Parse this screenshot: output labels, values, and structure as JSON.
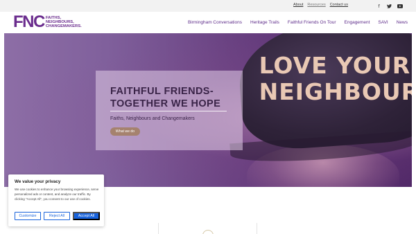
{
  "topbar": {
    "links": [
      "About",
      "Resources",
      "Contact us"
    ],
    "social_icons": [
      "facebook-icon",
      "twitter-icon",
      "youtube-icon"
    ]
  },
  "logo": {
    "mark": "FNC",
    "lines": [
      "FAITHS,",
      "NEIGHBOURS,",
      "CHANGEMAKERS."
    ]
  },
  "nav": {
    "items": [
      "Birmingham Conversations",
      "Heritage Trails",
      "Faithful Friends On Tour",
      "Engagement",
      "SAVI",
      "News"
    ]
  },
  "hero": {
    "cap_text_line1": "LOVE YOUR",
    "cap_text_line2": "NEIGHBOUR",
    "title_line1": "FAITHFUL FRIENDS-",
    "title_line2": "TOGETHER WE HOPE",
    "subtitle": "Faiths, Neighbours and Changemakers",
    "button_label": "What we do"
  },
  "cookie": {
    "title": "We value your privacy",
    "body": "We use cookies to enhance your browsing experience, serve personalized ads or content, and analyze our traffic. By clicking \"Accept All\", you consent to our use of cookies.",
    "customize_label": "Customize",
    "reject_label": "Reject All",
    "accept_label": "Accept All"
  },
  "colors": {
    "brand_purple": "#6a2c8d",
    "button_tan": "#a5826e",
    "cookie_blue": "#1863dc"
  }
}
